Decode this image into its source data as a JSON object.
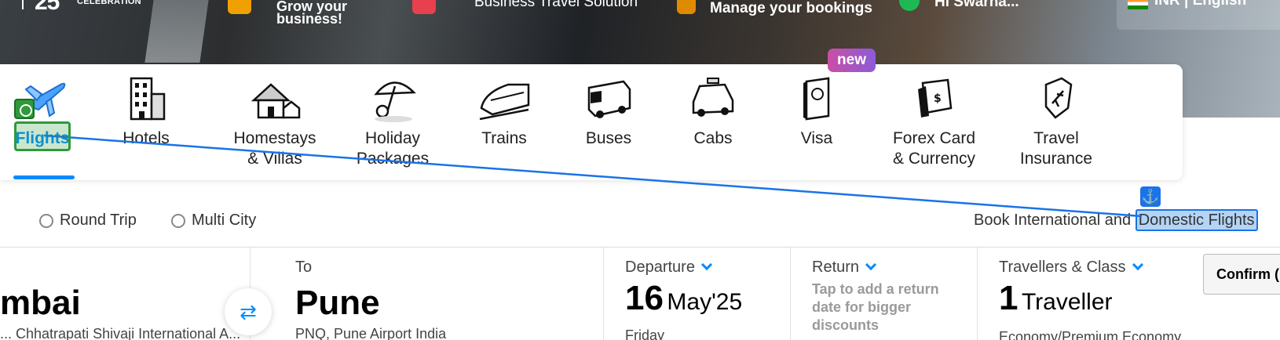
{
  "header": {
    "logo_subtext": "CELEBRATION",
    "logo_number": "25",
    "promo_line1": "Grow your",
    "promo_line2": "business!",
    "business_travel": "Business Travel Solution",
    "manage_bookings": "Manage your bookings",
    "user_greeting": "Hi Swarna...",
    "language": "INR | English"
  },
  "nav": {
    "badge_new": "new",
    "items": [
      {
        "label": "Flights",
        "icon": "airplane-icon"
      },
      {
        "label": "Hotels",
        "icon": "hotel-building-icon"
      },
      {
        "label": "Homestays\n& Villas",
        "icon": "house-icon"
      },
      {
        "label": "Holiday\nPackages",
        "icon": "beach-umbrella-icon"
      },
      {
        "label": "Trains",
        "icon": "train-icon"
      },
      {
        "label": "Buses",
        "icon": "bus-icon"
      },
      {
        "label": "Cabs",
        "icon": "car-icon"
      },
      {
        "label": "Visa",
        "icon": "passport-icon"
      },
      {
        "label": "Forex Card\n& Currency",
        "icon": "forex-card-icon"
      },
      {
        "label": "Travel\nInsurance",
        "icon": "shield-plane-icon"
      }
    ]
  },
  "trip_types": {
    "round_trip": "Round Trip",
    "multi_city": "Multi City"
  },
  "book_text": {
    "prefix": "Book International and ",
    "highlight": "Domestic Flights"
  },
  "form": {
    "from_city": "mbai",
    "from_airport": "... Chhatrapati Shivaji International A...",
    "to_label": "To",
    "to_city": "Pune",
    "to_airport": "PNQ, Pune Airport India",
    "departure_label": "Departure",
    "departure_day": "16",
    "departure_month": "May'25",
    "departure_weekday": "Friday",
    "return_label": "Return",
    "return_hint": "Tap to add a return date for bigger discounts",
    "travellers_label": "Travellers & Class",
    "travellers_count": "1",
    "travellers_word": "Traveller",
    "travel_class": "Economy/Premium Economy"
  },
  "confirm_label": "Confirm (I",
  "colors": {
    "accent": "#008cff",
    "highlight_overlay": "#1a73e8",
    "target_overlay": "#2e9a3a"
  }
}
